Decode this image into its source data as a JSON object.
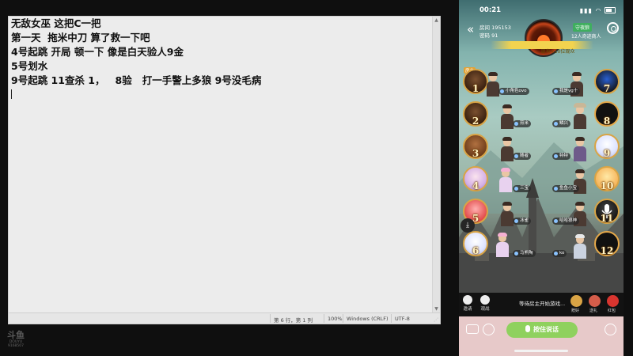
{
  "notepad": {
    "lines": [
      "无敌女巫 这把C一把",
      "第一天  拖米中刀 算了救一下吧",
      "4号起跳 开局 顿一下 像是白天验人9金",
      "5号划水",
      "9号起跳 11查杀 1，   8验   打一手警上多狼 9号没毛病"
    ],
    "status": {
      "position": "第 6 行，第 1 列",
      "zoom": "100%",
      "line_ending": "Windows (CRLF)",
      "encoding": "UTF-8"
    }
  },
  "watermark": {
    "logo": "斗鱼",
    "sub": "DOUYU",
    "num": "9168507"
  },
  "phone": {
    "time": "00:21",
    "room": {
      "id_label": "房间 195153",
      "password": "密码 91"
    },
    "mode_tag": "守夜狼",
    "players_tag": "12人奇迹商人",
    "notice": "现有<10位观众",
    "host_tag": "房主",
    "seats": [
      {
        "num": "1",
        "name": "小角色ovo"
      },
      {
        "num": "7",
        "name": "我是vg十"
      },
      {
        "num": "2",
        "name": "煎米"
      },
      {
        "num": "8",
        "name": "鳞兴"
      },
      {
        "num": "3",
        "name": "随者"
      },
      {
        "num": "9",
        "name": "特特"
      },
      {
        "num": "4",
        "name": "三宝"
      },
      {
        "num": "10",
        "name": "鱼鱼小宝"
      },
      {
        "num": "5",
        "name": "冰雀"
      },
      {
        "num": "11",
        "name": "哈哈狼神"
      },
      {
        "num": "6",
        "name": "马熊陶"
      },
      {
        "num": "12",
        "name": "ko"
      }
    ],
    "actions": {
      "invite": "邀请",
      "watch": "观战",
      "waiting": "等待房主开始游戏...",
      "gift": "赠好",
      "pack": "送礼",
      "redpack": "红包"
    },
    "ptt_label": "按住说话",
    "colors": {
      "ptt": "#8fd15e",
      "seat_ring": "#d9a445",
      "input_bar": "#e7c9c9"
    }
  }
}
